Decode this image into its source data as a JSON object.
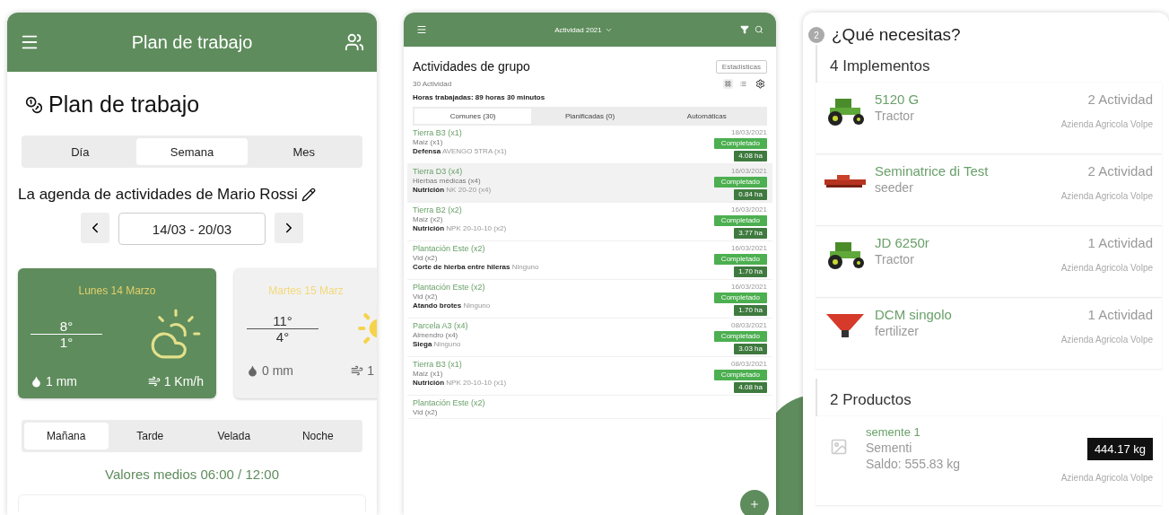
{
  "plan": {
    "header_title": "Plan de trabajo",
    "heading": "Plan de trabajo",
    "view_tabs": [
      {
        "label": "Día",
        "selected": false
      },
      {
        "label": "Semana",
        "selected": true
      },
      {
        "label": "Mes",
        "selected": false
      }
    ],
    "agenda_title": "La agenda de actividades de Mario Rossi",
    "date_range": "14/03 - 20/03",
    "weather": [
      {
        "day": "Lunes 14 Marzo",
        "max": "8°",
        "min": "1°",
        "rain": "1 mm",
        "wind": "1 Km/h",
        "selected": true
      },
      {
        "day": "Martes 15 Marz",
        "max": "11°",
        "min": "4°",
        "rain": "0 mm",
        "wind": "1",
        "selected": false
      }
    ],
    "periods": [
      {
        "label": "Mañana",
        "selected": true
      },
      {
        "label": "Tarde",
        "selected": false
      },
      {
        "label": "Velada",
        "selected": false
      },
      {
        "label": "Noche",
        "selected": false
      }
    ],
    "averages": "Valores medios 06:00 / 12:00"
  },
  "activities": {
    "header_title": "Actividad 2021",
    "title": "Actividades de grupo",
    "stats_button": "Estadísticas",
    "count": "30 Actividad",
    "hours": "Horas trabajadas: 89 horas 30 minutos",
    "tabs": [
      {
        "label": "Comunes (30)",
        "selected": true
      },
      {
        "label": "Planificadas (0)",
        "selected": false
      },
      {
        "label": "Automáticas",
        "selected": false
      }
    ],
    "rows": [
      {
        "field": "Tierra B3 (x1)",
        "crop": "Maíz (x1)",
        "operation": "Defensa",
        "product": "AVENGO 5TRA (x1)",
        "date": "18/03/2021",
        "status": "Completado",
        "area": "4.08 ha",
        "selected": false
      },
      {
        "field": "Tierra D3 (x4)",
        "crop": "Hierbas médicas (x4)",
        "operation": "Nutrición",
        "product": "NK 20-20 (x4)",
        "date": "16/03/2021",
        "status": "Completado",
        "area": "0.84 ha",
        "selected": true
      },
      {
        "field": "Tierra B2 (x2)",
        "crop": "Maíz (x2)",
        "operation": "Nutrición",
        "product": "NPK 20-10-10 (x2)",
        "date": "16/03/2021",
        "status": "Completado",
        "area": "3.77 ha",
        "selected": false
      },
      {
        "field": "Plantación Este (x2)",
        "crop": "Vid (x2)",
        "operation": "Corte de hierba entre hileras",
        "product": "Ninguno",
        "date": "16/03/2021",
        "status": "Completado",
        "area": "1.70 ha",
        "selected": false
      },
      {
        "field": "Plantación Este (x2)",
        "crop": "Vid (x2)",
        "operation": "Atando brotes",
        "product": "Ninguno",
        "date": "16/03/2021",
        "status": "Completado",
        "area": "1.70 ha",
        "selected": false
      },
      {
        "field": "Parcela A3 (x4)",
        "crop": "Almendro (x4)",
        "operation": "Siega",
        "product": "Ninguno",
        "date": "08/03/2021",
        "status": "Completado",
        "area": "3.03 ha",
        "selected": false
      },
      {
        "field": "Tierra B3 (x1)",
        "crop": "Maíz (x1)",
        "operation": "Nutrición",
        "product": "NPK 20-10-10 (x1)",
        "date": "08/03/2021",
        "status": "Completado",
        "area": "4.08 ha",
        "selected": false
      },
      {
        "field": "Plantación Este (x2)",
        "crop": "Vid (x2)",
        "selected": false
      }
    ]
  },
  "needs": {
    "step": "2",
    "title": "¿Qué necesitas?",
    "implements_title": "4 Implementos",
    "implements": [
      {
        "kind": "tractor",
        "name": "5120 G",
        "type": "Tractor",
        "count": "2 Actividad",
        "farm": "Azienda Agricola Volpe"
      },
      {
        "kind": "seeder",
        "name": "Seminatrice di Test",
        "type": "seeder",
        "count": "2 Actividad",
        "farm": "Azienda Agricola Volpe"
      },
      {
        "kind": "tractor",
        "name": "JD 6250r",
        "type": "Tractor",
        "count": "1 Actividad",
        "farm": "Azienda Agricola Volpe"
      },
      {
        "kind": "spreader",
        "name": "DCM singolo",
        "type": "fertilizer",
        "count": "1 Actividad",
        "farm": "Azienda Agricola Volpe"
      }
    ],
    "products_title": "2 Productos",
    "products": [
      {
        "name": "semente 1",
        "category": "Sementi",
        "balance": "Saldo: 555.83 kg",
        "quantity": "444.17 kg",
        "farm": "Azienda Agricola Volpe"
      }
    ]
  }
}
